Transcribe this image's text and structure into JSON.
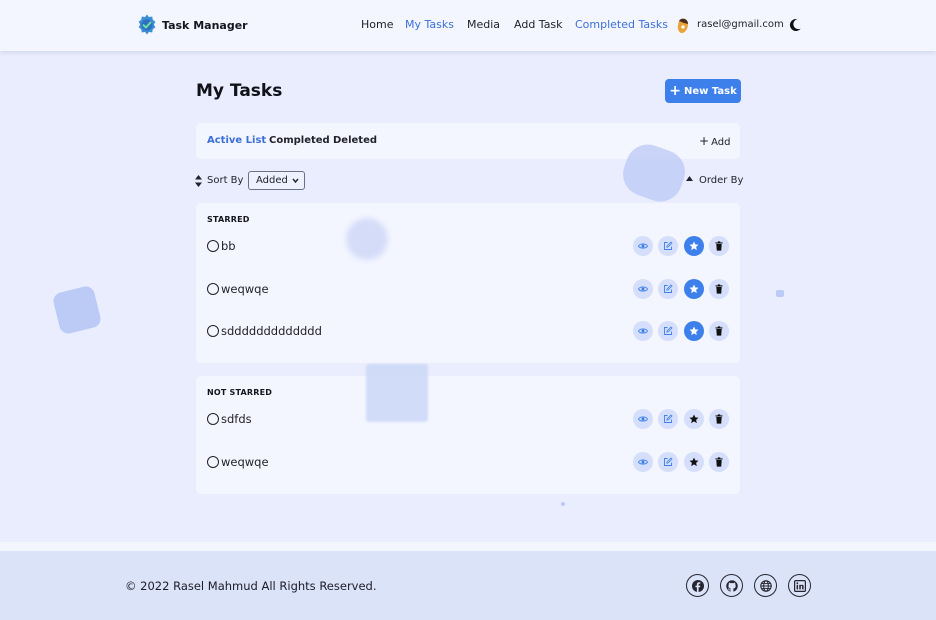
{
  "brand": {
    "name": "Task Manager",
    "logo_icon": "gear-check-logo"
  },
  "nav": {
    "home": "Home",
    "my_tasks": "My Tasks",
    "media": "Media",
    "add_task": "Add Task",
    "completed_tasks": "Completed Tasks",
    "user_email": "rasel@gmail.com"
  },
  "page": {
    "title": "My Tasks",
    "new_task_label": "New Task"
  },
  "tabs": {
    "active": "Active List",
    "completed": "Completed",
    "deleted": "Deleted",
    "add": "Add"
  },
  "sort": {
    "label": "Sort By",
    "selected": "Added",
    "order_label": "Order By"
  },
  "starred": {
    "heading": "STARRED",
    "tasks": [
      {
        "title": "bb",
        "starred": true
      },
      {
        "title": "weqwqe",
        "starred": true
      },
      {
        "title": "sddddddddddddd",
        "starred": true
      }
    ]
  },
  "not_starred": {
    "heading": "NOT STARRED",
    "tasks": [
      {
        "title": "sdfds",
        "starred": false
      },
      {
        "title": "weqwqe",
        "starred": false
      }
    ]
  },
  "footer": {
    "copyright": "© 2022 Rasel Mahmud All Rights Reserved."
  },
  "colors": {
    "accent": "#3d80ec",
    "active_link": "#3b6fd8",
    "background": "#eaedfd",
    "card": "#f4f6ff",
    "action_circle": "#d5defa"
  }
}
